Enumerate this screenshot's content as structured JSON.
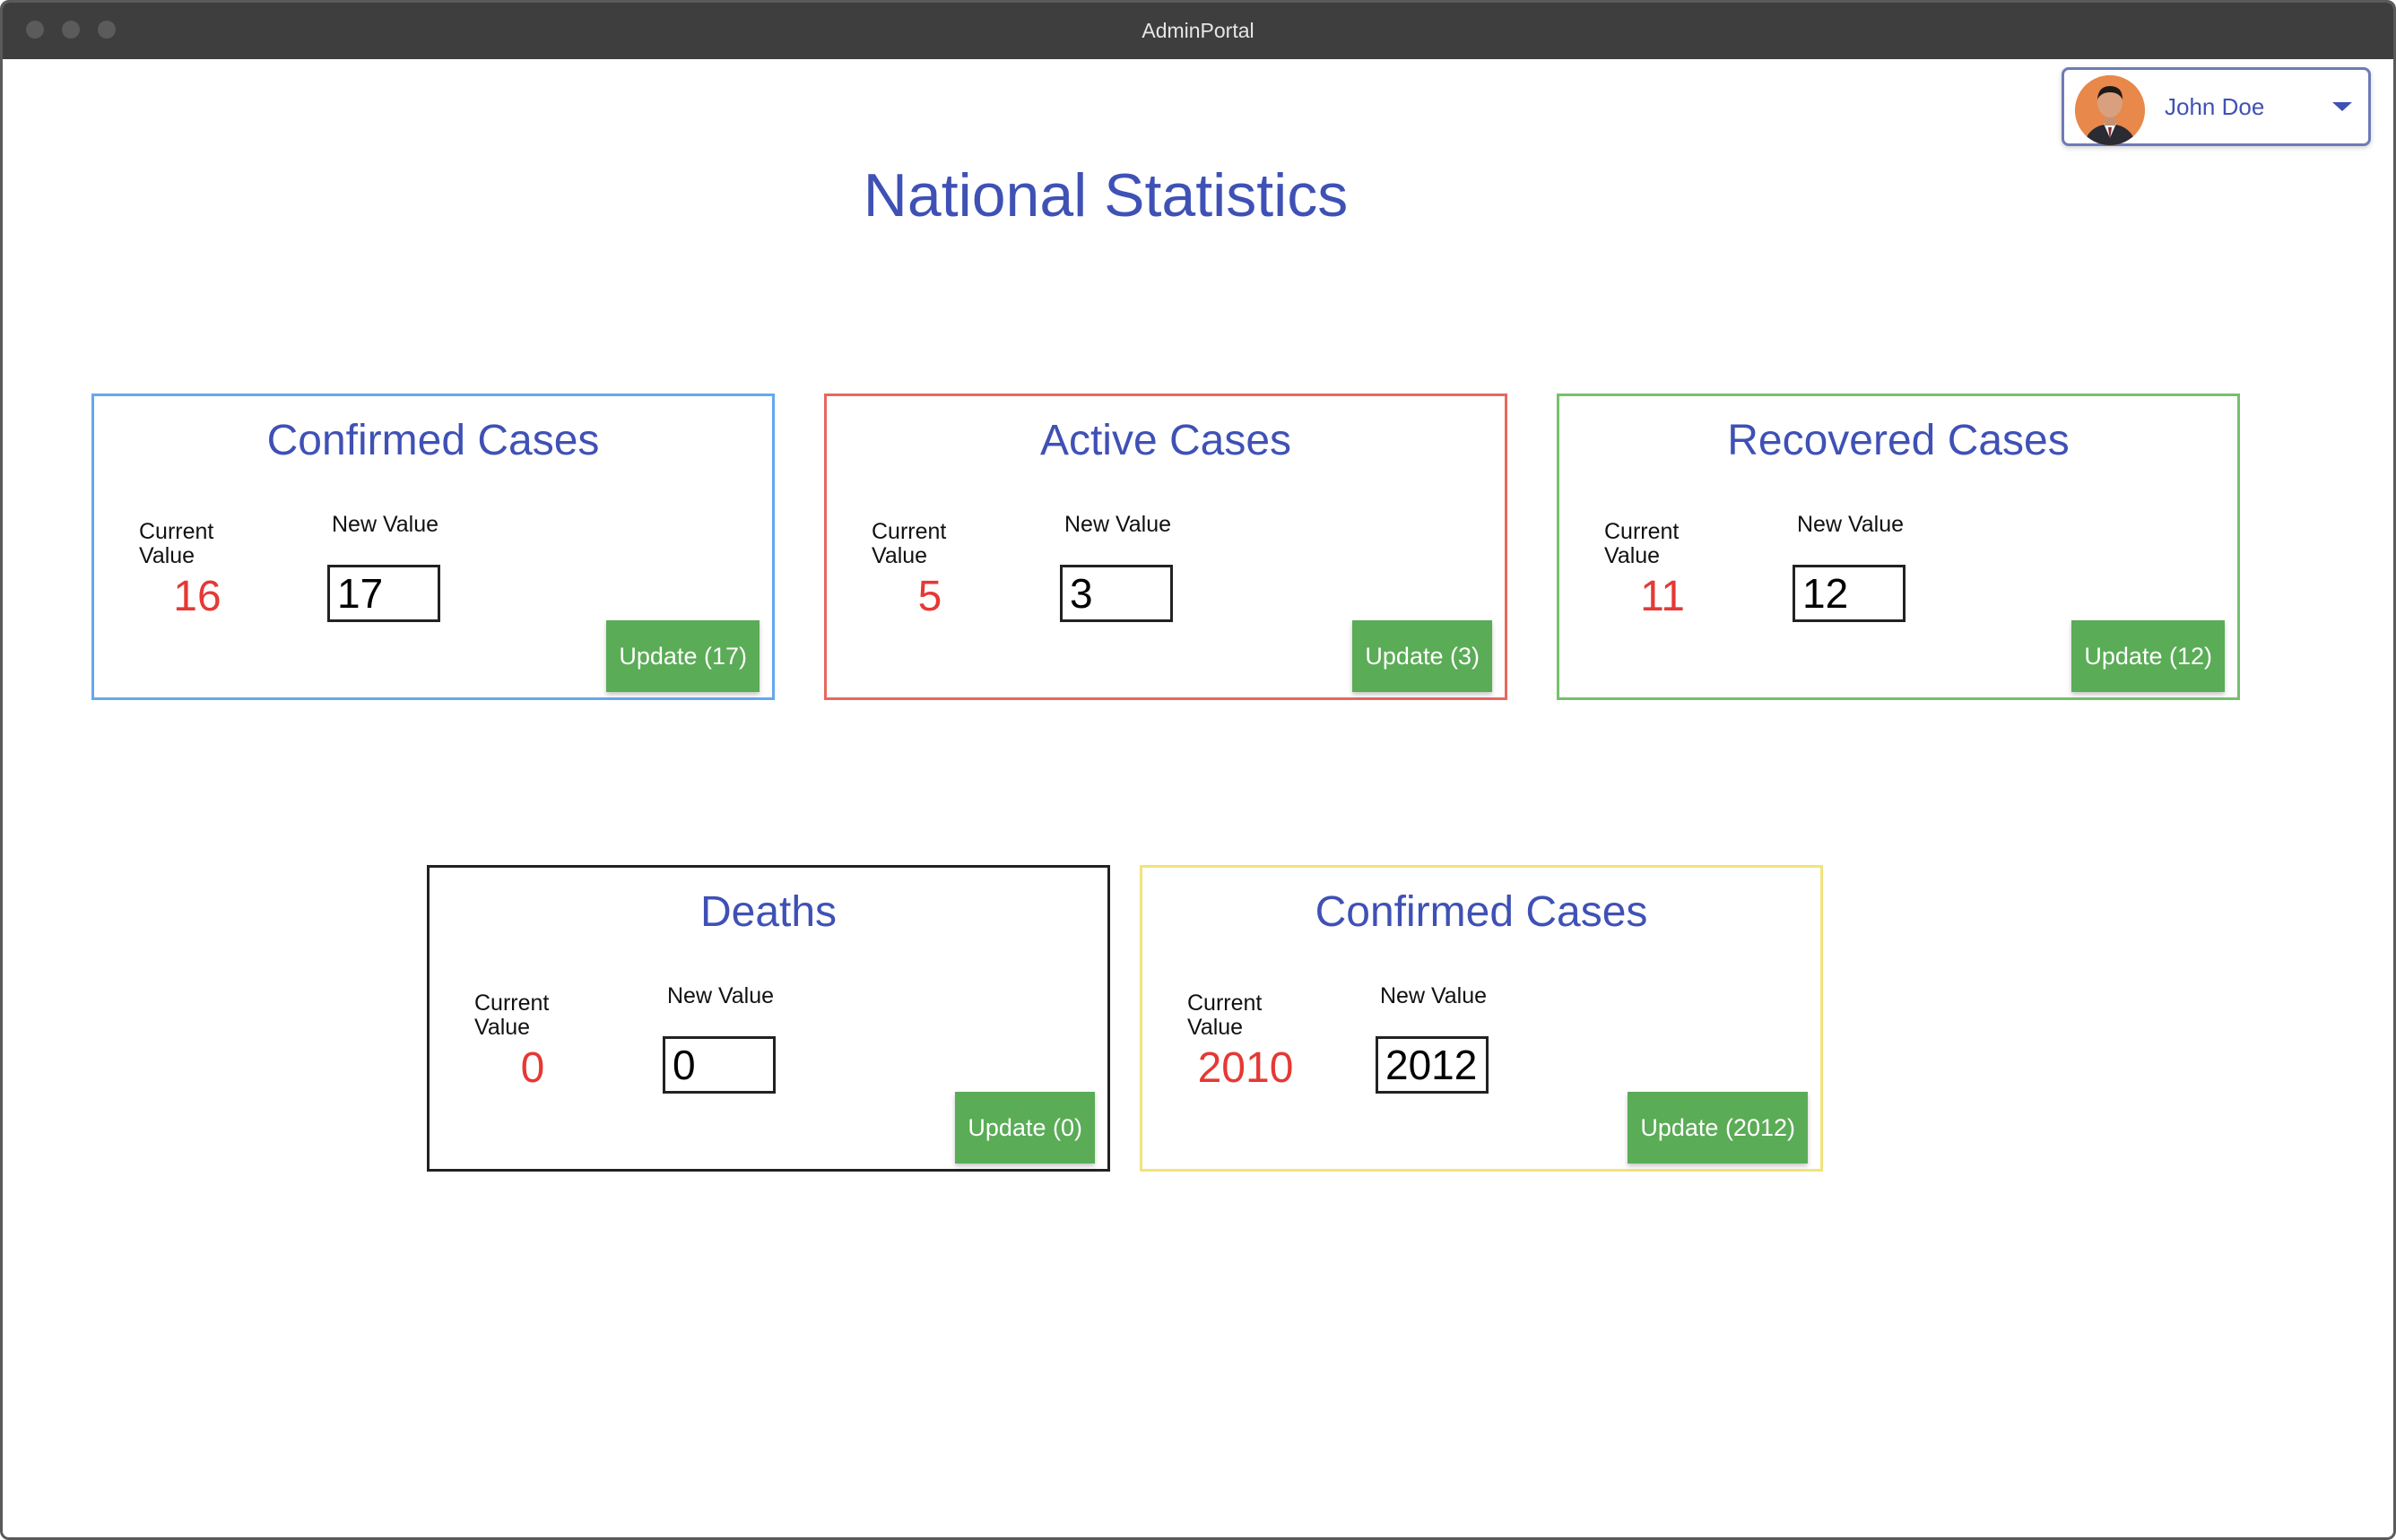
{
  "window": {
    "title": "AdminPortal"
  },
  "user": {
    "name": "John Doe",
    "avatar_icon": "user-avatar-icon"
  },
  "page": {
    "title": "National Statistics"
  },
  "colors": {
    "accent": "#3f51b5",
    "value": "#e53935",
    "button": "#5aac56"
  },
  "labels": {
    "current": "Current Value",
    "new": "New Value"
  },
  "cards": [
    {
      "title": "Confirmed Cases",
      "current_value": "16",
      "new_value": "17",
      "button_label": "Update (17)",
      "border_color": "#64a8ef"
    },
    {
      "title": "Active Cases",
      "current_value": "5",
      "new_value": "3",
      "button_label": "Update (3)",
      "border_color": "#e8675f"
    },
    {
      "title": "Recovered Cases",
      "current_value": "11",
      "new_value": "12",
      "button_label": "Update (12)",
      "border_color": "#75c06c"
    },
    {
      "title": "Deaths",
      "current_value": "0",
      "new_value": "0",
      "button_label": "Update (0)",
      "border_color": "#222222"
    },
    {
      "title": "Confirmed Cases",
      "current_value": "2010",
      "new_value": "2012",
      "button_label": "Update (2012)",
      "border_color": "#f3e37a"
    }
  ]
}
